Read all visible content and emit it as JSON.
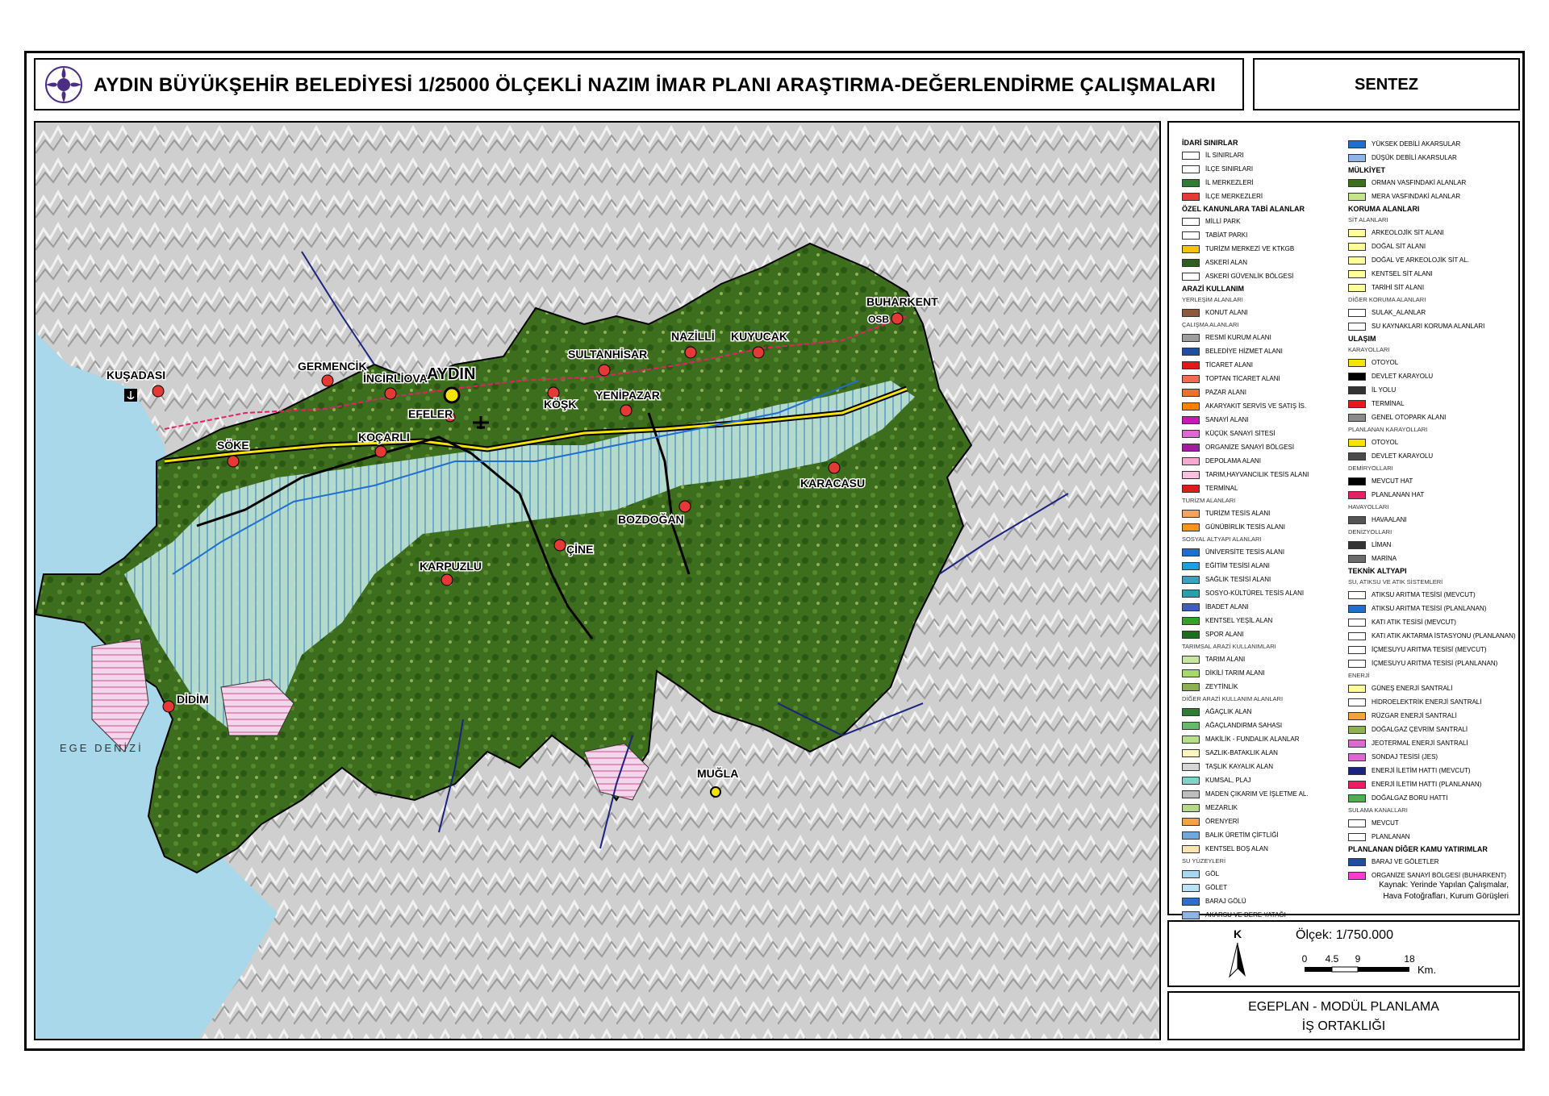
{
  "header": {
    "title": "AYDIN BÜYÜKŞEHİR BELEDİYESİ 1/25000 ÖLÇEKLİ NAZIM İMAR PLANI ARAŞTIRMA-DEĞERLENDİRME ÇALIŞMALARI",
    "sheet": "SENTEZ"
  },
  "map_labels": {
    "kusadasi": "KUŞADASI",
    "germencik": "GERMENCİK",
    "incirliova": "İNCİRLİOVA",
    "aydin": "AYDIN",
    "efeler": "EFELER",
    "koçarli": "KOÇARLI",
    "soke": "SÖKE",
    "sultanhisar": "SULTANHİSAR",
    "nazilli": "NAZİLLİ",
    "kuyucak": "KUYUCAK",
    "buharkent": "BUHARKENT",
    "kosk": "KÖŞK",
    "yenipazar": "YENİPAZAR",
    "bozdogan": "BOZDOĞAN",
    "karacasu": "KARACASU",
    "cine": "ÇİNE",
    "karpuzlu": "KARPUZLU",
    "didim": "DİDİM",
    "mugla": "MUĞLA",
    "ege_denizi": "EGE DENİZİ",
    "osb": "OSB"
  },
  "legend": {
    "col1": [
      {
        "type": "head",
        "text": "İDARİ SINIRLAR"
      },
      {
        "type": "item",
        "text": "İL SINIRLARI",
        "color": "#ffffff"
      },
      {
        "type": "item",
        "text": "İLÇE SINIRLARI",
        "color": "#ffffff"
      },
      {
        "type": "item",
        "text": "İL MERKEZLERİ",
        "color": "#2e7d32"
      },
      {
        "type": "item",
        "text": "İLÇE MERKEZLERİ",
        "color": "#e53935"
      },
      {
        "type": "head",
        "text": "ÖZEL KANUNLARA TABİ ALANLAR"
      },
      {
        "type": "item",
        "text": "MİLLİ PARK",
        "color": "#ffffff"
      },
      {
        "type": "item",
        "text": "TABİAT PARKI",
        "color": "#ffffff"
      },
      {
        "type": "item",
        "text": "TURİZM MERKEZİ VE KTKGB",
        "color": "#f5c400"
      },
      {
        "type": "item",
        "text": "ASKERİ ALAN",
        "color": "#2f5d1e"
      },
      {
        "type": "item",
        "text": "ASKERİ GÜVENLİK BÖLGESİ",
        "color": "#ffffff"
      },
      {
        "type": "head",
        "text": "ARAZİ KULLANIM"
      },
      {
        "type": "sub",
        "text": "YERLEŞİM ALANLARI"
      },
      {
        "type": "item",
        "text": "KONUT ALANI",
        "color": "#8d5a3b"
      },
      {
        "type": "sub",
        "text": "ÇALIŞMA ALANLARI"
      },
      {
        "type": "item",
        "text": "RESMİ KURUM ALANI",
        "color": "#9e9e9e"
      },
      {
        "type": "item",
        "text": "BELEDİYE HİZMET ALANI",
        "color": "#1f4ea1"
      },
      {
        "type": "item",
        "text": "TİCARET ALANI",
        "color": "#e31a1c"
      },
      {
        "type": "item",
        "text": "TOPTAN TİCARET ALANI",
        "color": "#f26c4f"
      },
      {
        "type": "item",
        "text": "PAZAR ALANI",
        "color": "#e8742b"
      },
      {
        "type": "item",
        "text": "AKARYAKIT SERVİS VE SATIŞ İS.",
        "color": "#ff7f00"
      },
      {
        "type": "item",
        "text": "SANAYİ ALANI",
        "color": "#c51bb3"
      },
      {
        "type": "item",
        "text": "KÜÇÜK SANAYİ SİTESİ",
        "color": "#e066d0"
      },
      {
        "type": "item",
        "text": "ORGANİZE SANAYİ BÖLGESİ",
        "color": "#a31aa3"
      },
      {
        "type": "item",
        "text": "DEPOLAMA ALANI",
        "color": "#f5a9d0"
      },
      {
        "type": "item",
        "text": "TARIM,HAYVANCILIK TESİS ALANI",
        "color": "#ffc0e0"
      },
      {
        "type": "item",
        "text": "TERMİNAL",
        "color": "#e31a1c"
      },
      {
        "type": "sub",
        "text": "TURİZM ALANLARI"
      },
      {
        "type": "item",
        "text": "TURİZM TESİS ALANI",
        "color": "#f4a460"
      },
      {
        "type": "item",
        "text": "GÜNÜBİRLİK TESİS ALANI",
        "color": "#f7941d"
      },
      {
        "type": "sub",
        "text": "SOSYAL ALTYAPI ALANLARI"
      },
      {
        "type": "item",
        "text": "ÜNİVERSİTE TESİS ALANI",
        "color": "#1f6fd1"
      },
      {
        "type": "item",
        "text": "EĞİTİM TESİSİ ALANI",
        "color": "#1ea0e0"
      },
      {
        "type": "item",
        "text": "SAĞLIK TESİSİ ALANI",
        "color": "#3aa0c8"
      },
      {
        "type": "item",
        "text": "SOSYO-KÜLTÜREL TESİS ALANI",
        "color": "#2a9fae"
      },
      {
        "type": "item",
        "text": "İBADET ALANI",
        "color": "#3f5fbf"
      },
      {
        "type": "item",
        "text": "KENTSEL YEŞİL ALAN",
        "color": "#33a02c"
      },
      {
        "type": "item",
        "text": "SPOR ALANI",
        "color": "#1b6e1b"
      },
      {
        "type": "sub",
        "text": "TARIMSAL ARAZİ KULLANIMLARI"
      },
      {
        "type": "item",
        "text": "TARIM ALANI",
        "color": "#c8e6a0"
      },
      {
        "type": "item",
        "text": "DİKİLİ TARIM ALANI",
        "color": "#a6d96a"
      },
      {
        "type": "item",
        "text": "ZEYTİNLİK",
        "color": "#8db052"
      },
      {
        "type": "sub",
        "text": "DİĞER ARAZİ KULLANIM ALANLARI"
      },
      {
        "type": "item",
        "text": "AĞAÇLIK ALAN",
        "color": "#2e7d32"
      },
      {
        "type": "item",
        "text": "AĞAÇLANDIRMA SAHASI",
        "color": "#66bb6a"
      },
      {
        "type": "item",
        "text": "MAKİLİK - FUNDALIK ALANLAR",
        "color": "#b7e08a"
      },
      {
        "type": "item",
        "text": "SAZLIK-BATAKLIK ALAN",
        "color": "#fff3c0"
      },
      {
        "type": "item",
        "text": "TAŞLIK KAYALIK ALAN",
        "color": "#d6d6d6"
      },
      {
        "type": "item",
        "text": "KUMSAL, PLAJ",
        "color": "#7fd3c8"
      },
      {
        "type": "item",
        "text": "MADEN ÇIKARIM VE İŞLETME AL.",
        "color": "#bdbdbd"
      },
      {
        "type": "item",
        "text": "MEZARLIK",
        "color": "#b5d98a"
      },
      {
        "type": "item",
        "text": "ÖRENYERİ",
        "color": "#f4a340"
      },
      {
        "type": "item",
        "text": "BALIK ÜRETİM ÇİFTLİĞİ",
        "color": "#6fa8dc"
      },
      {
        "type": "item",
        "text": "KENTSEL BOŞ ALAN",
        "color": "#fce4b0"
      },
      {
        "type": "sub",
        "text": "SU YÜZEYLERİ"
      },
      {
        "type": "item",
        "text": "GÖL",
        "color": "#a8d8f0"
      },
      {
        "type": "item",
        "text": "GÖLET",
        "color": "#b9e3f5"
      },
      {
        "type": "item",
        "text": "BARAJ GÖLÜ",
        "color": "#2a6fc9"
      },
      {
        "type": "item",
        "text": "AKARSU VE DERE YATAĞI",
        "color": "#8fb4e8"
      }
    ],
    "col2": [
      {
        "type": "item",
        "text": "YÜKSEK DEBİLİ AKARSULAR",
        "color": "#1f6fd1"
      },
      {
        "type": "item",
        "text": "DÜŞÜK DEBİLİ AKARSULAR",
        "color": "#8fb4e8"
      },
      {
        "type": "head",
        "text": "MÜLKİYET"
      },
      {
        "type": "item",
        "text": "ORMAN VASFINDAKİ ALANLAR",
        "color": "#3c6e1e"
      },
      {
        "type": "item",
        "text": "MERA VASFINDAKİ ALANLAR",
        "color": "#c6e48b"
      },
      {
        "type": "head",
        "text": "KORUMA ALANLARI"
      },
      {
        "type": "sub",
        "text": "SİT ALANLARI"
      },
      {
        "type": "item",
        "text": "ARKEOLOJİK SİT ALANI",
        "color": "#ffff99"
      },
      {
        "type": "item",
        "text": "DOĞAL SİT ALANI",
        "color": "#ffff99"
      },
      {
        "type": "item",
        "text": "DOĞAL VE ARKEOLOJİK SİT AL.",
        "color": "#ffff99"
      },
      {
        "type": "item",
        "text": "KENTSEL SİT ALANI",
        "color": "#ffff99"
      },
      {
        "type": "item",
        "text": "TARİHİ SİT ALANI",
        "color": "#ffff99"
      },
      {
        "type": "sub",
        "text": "DİĞER KORUMA ALANLARI"
      },
      {
        "type": "item",
        "text": "SULAK_ALANLAR",
        "color": "#ffffff"
      },
      {
        "type": "item",
        "text": "SU KAYNAKLARI KORUMA ALANLARI",
        "color": "#ffffff"
      },
      {
        "type": "head",
        "text": "ULAŞIM"
      },
      {
        "type": "sub",
        "text": "KARAYOLLARI"
      },
      {
        "type": "item",
        "text": "OTOYOL",
        "color": "#f5e400"
      },
      {
        "type": "item",
        "text": "DEVLET KARAYOLU",
        "color": "#000000"
      },
      {
        "type": "item",
        "text": "İL YOLU",
        "color": "#333333"
      },
      {
        "type": "item",
        "text": "TERMİNAL",
        "color": "#e31a1c"
      },
      {
        "type": "item",
        "text": "GENEL OTOPARK ALANI",
        "color": "#8a8a8a"
      },
      {
        "type": "sub",
        "text": "PLANLANAN KARAYOLLARI"
      },
      {
        "type": "item",
        "text": "OTOYOL",
        "color": "#f5e400"
      },
      {
        "type": "item",
        "text": "DEVLET KARAYOLU",
        "color": "#4a4a4a"
      },
      {
        "type": "sub",
        "text": "DEMİRYOLLARI"
      },
      {
        "type": "item",
        "text": "MEVCUT HAT",
        "color": "#000000"
      },
      {
        "type": "item",
        "text": "PLANLANAN HAT",
        "color": "#e91e63"
      },
      {
        "type": "sub",
        "text": "HAVAYOLLARI"
      },
      {
        "type": "item",
        "text": "HAVAALANI",
        "color": "#555555"
      },
      {
        "type": "sub",
        "text": "DENİZYOLLARI"
      },
      {
        "type": "item",
        "text": "LİMAN",
        "color": "#333333"
      },
      {
        "type": "item",
        "text": "MARİNA",
        "color": "#6b6b6b"
      },
      {
        "type": "head",
        "text": "TEKNİK ALTYAPI"
      },
      {
        "type": "sub",
        "text": "SU, ATIKSU VE ATIK SİSTEMLERİ"
      },
      {
        "type": "item",
        "text": "ATIKSU ARITMA TESİSİ (MEVCUT)",
        "color": "#ffffff"
      },
      {
        "type": "item",
        "text": "ATIKSU ARITMA TESİSİ (PLANLANAN)",
        "color": "#1f6fd1"
      },
      {
        "type": "item",
        "text": "KATI ATIK TESİSİ (MEVCUT)",
        "color": "#ffffff"
      },
      {
        "type": "item",
        "text": "KATI ATIK AKTARMA İSTASYONU (PLANLANAN)",
        "color": "#ffffff"
      },
      {
        "type": "item",
        "text": "İÇMESUYU ARITMA TESİSİ (MEVCUT)",
        "color": "#ffffff"
      },
      {
        "type": "item",
        "text": "İÇMESUYU ARITMA TESİSİ (PLANLANAN)",
        "color": "#ffffff"
      },
      {
        "type": "sub",
        "text": "ENERJİ"
      },
      {
        "type": "item",
        "text": "GÜNEŞ ENERJİ SANTRALİ",
        "color": "#ffff99"
      },
      {
        "type": "item",
        "text": "HİDROELEKTRİK ENERJİ SANTRALİ",
        "color": "#ffffff"
      },
      {
        "type": "item",
        "text": "RÜZGAR ENERJİ SANTRALİ",
        "color": "#f4a340"
      },
      {
        "type": "item",
        "text": "DOĞALGAZ ÇEVRİM SANTRALİ",
        "color": "#8db052"
      },
      {
        "type": "item",
        "text": "JEOTERMAL ENERJİ SANTRALİ",
        "color": "#e066d0"
      },
      {
        "type": "item",
        "text": "SONDAJ TESİSİ (JES)",
        "color": "#e066d0"
      },
      {
        "type": "item",
        "text": "ENERJİ İLETİM HATTI (MEVCUT)",
        "color": "#1a237e"
      },
      {
        "type": "item",
        "text": "ENERJİ İLETİM HATTI (PLANLANAN)",
        "color": "#e91e63"
      },
      {
        "type": "item",
        "text": "DOĞALGAZ BORU HATTI",
        "color": "#4caf50"
      },
      {
        "type": "sub",
        "text": "SULAMA KANALLARI"
      },
      {
        "type": "item",
        "text": "MEVCUT",
        "color": "#ffffff"
      },
      {
        "type": "item",
        "text": "PLANLANAN",
        "color": "#ffffff"
      },
      {
        "type": "head",
        "text": "PLANLANAN DİĞER KAMU YATIRIMLAR"
      },
      {
        "type": "item",
        "text": "BARAJ VE GÖLETLER",
        "color": "#1f4ea1"
      },
      {
        "type": "item",
        "text": "ORGANİZE SANAYİ BÖLGESİ (BUHARKENT)",
        "color": "#ff3bd4"
      }
    ],
    "source_line1": "Kaynak: Yerinde Yapılan Çalışmalar,",
    "source_line2": "Hava Fotoğrafları, Kurum Görüşleri"
  },
  "scale": {
    "north": "K",
    "label": "Ölçek: 1/750.000",
    "ticks": [
      "0",
      "4.5",
      "9",
      "18"
    ],
    "unit": "Km."
  },
  "credits": {
    "line1": "EGEPLAN - MODÜL PLANLAMA",
    "line2": "İŞ ORTAKLIĞI"
  },
  "colors": {
    "sea": "#a9d8ea",
    "relief": "#d0d0d0",
    "forest": "#3c6e1e",
    "agri": "#a9d8c8",
    "motorway": "#f5e400",
    "district_center": "#e53935"
  }
}
